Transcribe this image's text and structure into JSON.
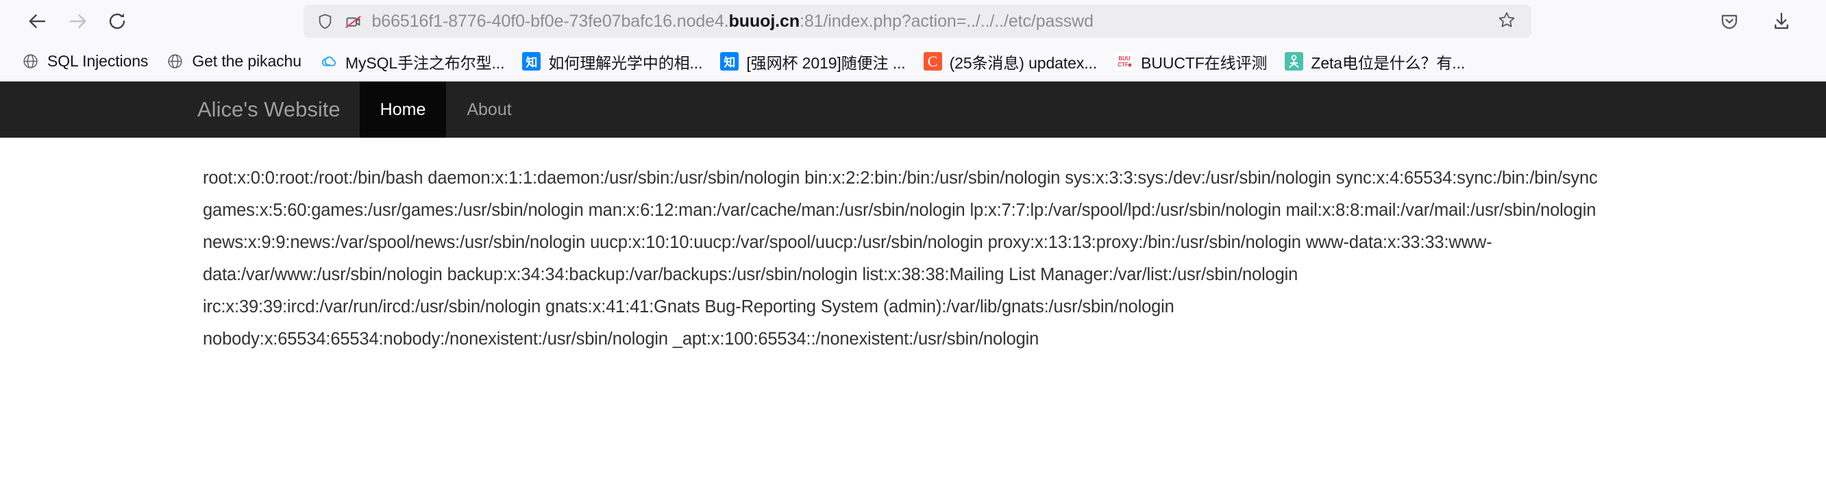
{
  "browser": {
    "back_icon": "back-arrow-icon",
    "forward_icon": "forward-arrow-icon",
    "reload_icon": "reload-icon",
    "shield_icon": "shield-icon",
    "permission_blocked_icon": "camera-microphone-blocked-icon",
    "star_icon": "bookmark-star-icon",
    "pocket_icon": "pocket-icon",
    "downloads_icon": "downloads-icon",
    "url": {
      "prefix": "b66516f1-8776-40f0-bf0e-73fe07bafc16.node4.",
      "domain": "buuoj.cn",
      "suffix": ":81/index.php?action=../../../etc/passwd",
      "full": "b66516f1-8776-40f0-bf0e-73fe07bafc16.node4.buuoj.cn:81/index.php?action=../../../etc/passwd"
    }
  },
  "bookmarks": [
    {
      "label": "SQL Injections",
      "icon": "globe-icon",
      "icon_kind": "globe"
    },
    {
      "label": "Get the pikachu",
      "icon": "globe-icon",
      "icon_kind": "globe"
    },
    {
      "label": "MySQL手注之布尔型...",
      "icon": "cloud-icon",
      "icon_kind": "cloud"
    },
    {
      "label": "如何理解光学中的相...",
      "icon": "zhihu-icon",
      "icon_kind": "zhihu",
      "icon_text": "知"
    },
    {
      "label": "[强网杯 2019]随便注 ...",
      "icon": "zhihu-icon",
      "icon_kind": "zhihu",
      "icon_text": "知"
    },
    {
      "label": "(25条消息) updatex...",
      "icon": "csdn-icon",
      "icon_kind": "csdn",
      "icon_text": "C"
    },
    {
      "label": "BUUCTF在线评测",
      "icon": "buuctf-icon",
      "icon_kind": "buuctf",
      "icon_text": "BUU\nCTF"
    },
    {
      "label": "Zeta电位是什么？有...",
      "icon": "zeta-icon",
      "icon_kind": "zeta"
    }
  ],
  "site": {
    "brand": "Alice's Website",
    "nav": [
      {
        "label": "Home",
        "active": true
      },
      {
        "label": "About",
        "active": false
      }
    ]
  },
  "main": {
    "passwd_output": "root:x:0:0:root:/root:/bin/bash daemon:x:1:1:daemon:/usr/sbin:/usr/sbin/nologin bin:x:2:2:bin:/bin:/usr/sbin/nologin sys:x:3:3:sys:/dev:/usr/sbin/nologin sync:x:4:65534:sync:/bin:/bin/sync games:x:5:60:games:/usr/games:/usr/sbin/nologin man:x:6:12:man:/var/cache/man:/usr/sbin/nologin lp:x:7:7:lp:/var/spool/lpd:/usr/sbin/nologin mail:x:8:8:mail:/var/mail:/usr/sbin/nologin news:x:9:9:news:/var/spool/news:/usr/sbin/nologin uucp:x:10:10:uucp:/var/spool/uucp:/usr/sbin/nologin proxy:x:13:13:proxy:/bin:/usr/sbin/nologin www-data:x:33:33:www-data:/var/www:/usr/sbin/nologin backup:x:34:34:backup:/var/backups:/usr/sbin/nologin list:x:38:38:Mailing List Manager:/var/list:/usr/sbin/nologin irc:x:39:39:ircd:/var/run/ircd:/usr/sbin/nologin gnats:x:41:41:Gnats Bug-Reporting System (admin):/var/lib/gnats:/usr/sbin/nologin nobody:x:65534:65534:nobody:/nonexistent:/usr/sbin/nologin _apt:x:100:65534::/nonexistent:/usr/sbin/nologin"
  },
  "colors": {
    "chrome_bg": "#f9f9fb",
    "urlbar_bg": "#ededf0",
    "navbar_bg": "#222222",
    "navbar_active_bg": "#080808",
    "text": "#333333"
  }
}
